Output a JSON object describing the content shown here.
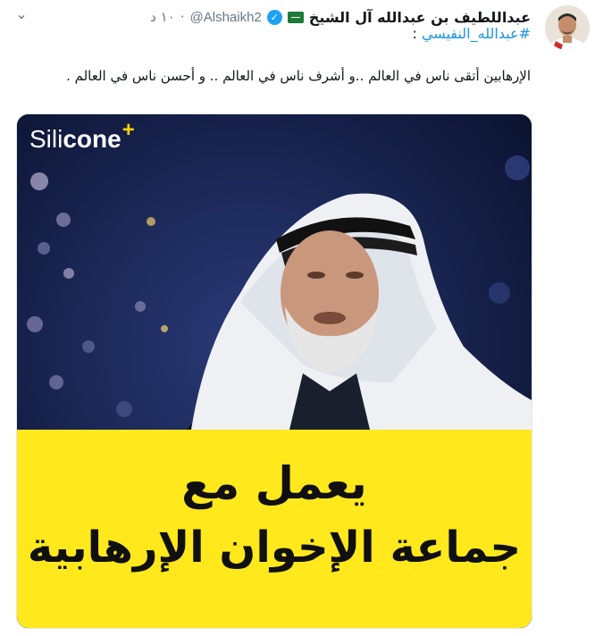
{
  "tweet": {
    "display_name": "عبداللطيف بن عبدالله آل الشيخ",
    "flag_icon": "saudi-flag",
    "verified_icon": "verified-badge-icon",
    "handle": "@Alshaikh2",
    "separator": "·",
    "time": "١٠ د",
    "hashtag": "#عبدالله_النفيسي",
    "hashtag_suffix": " :",
    "body": "الإرهابين أتقى ناس في العالم ..و أشرف ناس في العالم .. و أحسن ناس في العالم .",
    "accent_color": "#1b95e0"
  },
  "media": {
    "logo_light": "Sili",
    "logo_bold": "cone",
    "logo_plus": "+",
    "caption_line1": "يعمل مع",
    "caption_line2": "جماعة الإخوان الإرهابية",
    "caption_bg": "#ffe81c"
  }
}
